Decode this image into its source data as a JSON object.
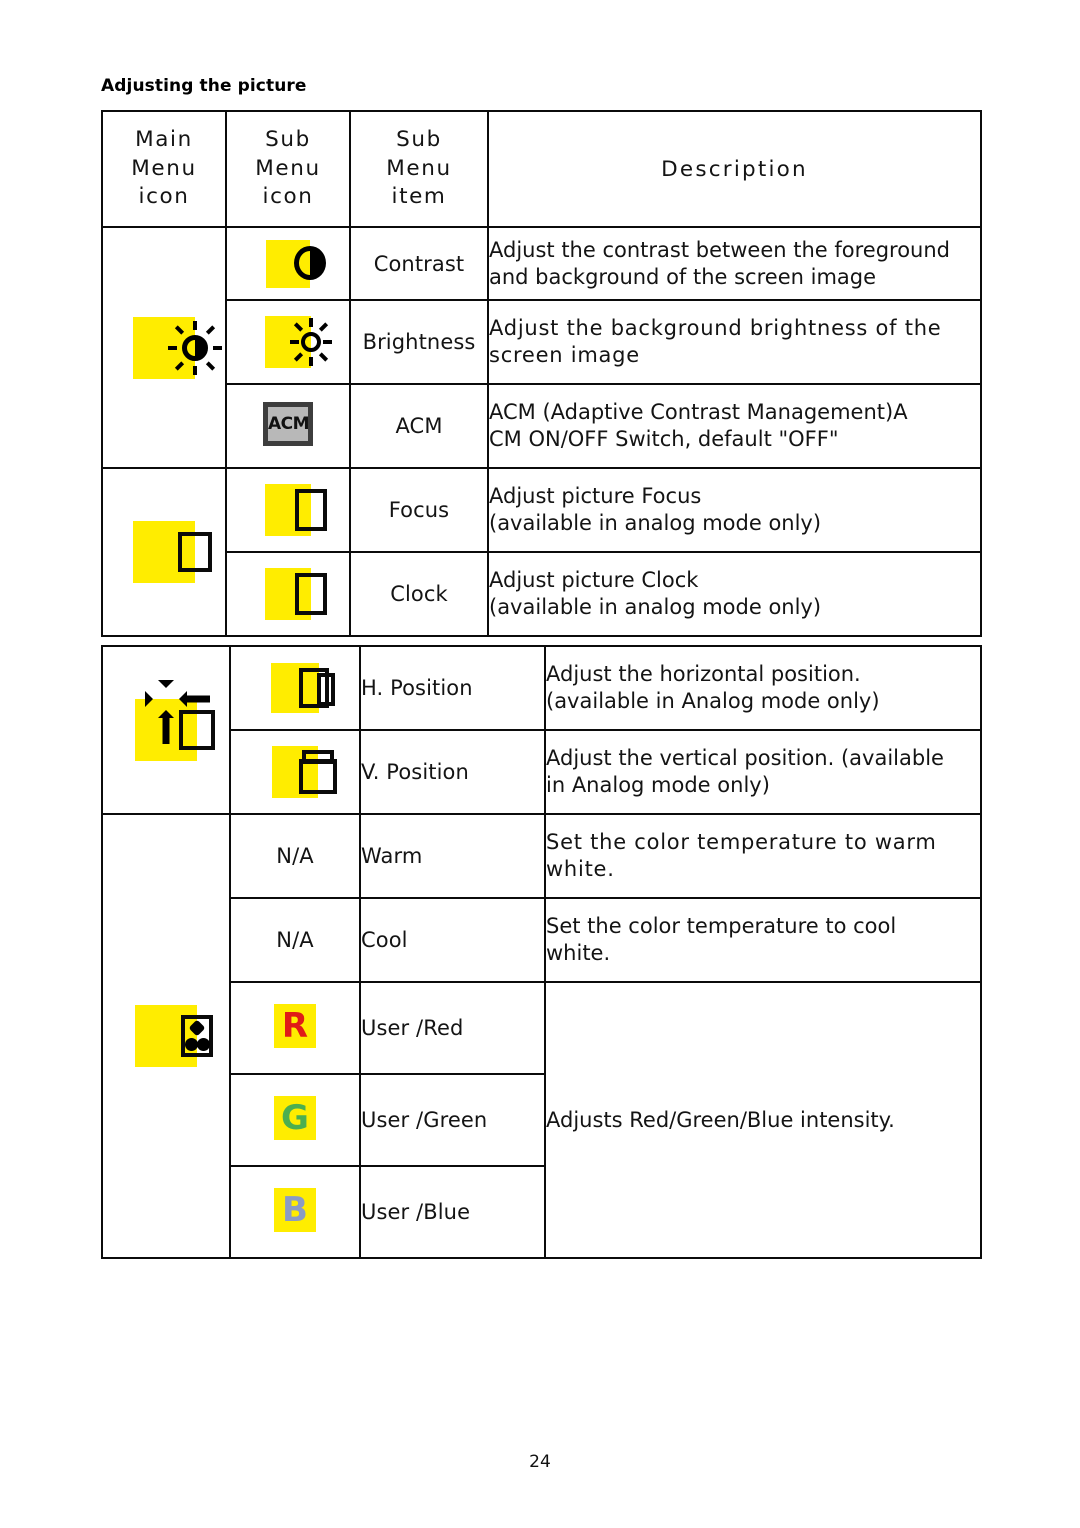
{
  "document": {
    "heading": "Adjusting the picture",
    "page_number": "24"
  },
  "table": {
    "headers": {
      "main_menu_icon": "Main\nMenu\nicon",
      "main_menu_icon_lines": [
        "Main",
        "Menu",
        "icon"
      ],
      "sub_menu_icon_lines": [
        "Sub",
        "Menu",
        "icon"
      ],
      "sub_menu_item_lines": [
        "Sub",
        "Menu",
        "item"
      ],
      "description": "Description"
    },
    "rows": [
      {
        "main_menu_icon": "brightness-sun-half-icon",
        "sub_menu_icon": "contrast-half-circle-icon",
        "sub_menu_item": "Contrast",
        "description": "Adjust the contrast between the foreground and background of the screen image"
      },
      {
        "main_menu_icon": "brightness-sun-half-icon",
        "sub_menu_icon": "brightness-sun-icon",
        "sub_menu_item": "Brightness",
        "description": "Adjust the background brightness of the screen image"
      },
      {
        "main_menu_icon": "brightness-sun-half-icon",
        "sub_menu_icon": "acm-icon",
        "sub_menu_item": "ACM",
        "description": "ACM (Adaptive Contrast Management)ACM ON/OFF Switch, default \"OFF\""
      },
      {
        "main_menu_icon": "focus-lines-icon",
        "sub_menu_icon": "focus-lines-icon",
        "sub_menu_item": "Focus",
        "description": "Adjust picture Focus (available in analog mode only)"
      },
      {
        "main_menu_icon": "focus-lines-icon",
        "sub_menu_icon": "clock-bars-icon",
        "sub_menu_item": "Clock",
        "description": "Adjust picture Clock (available in analog mode only)"
      },
      {
        "main_menu_icon": "position-arrows-icon",
        "sub_menu_icon": "h-position-icon",
        "sub_menu_item": "H. Position",
        "description": "Adjust the horizontal position. (available in Analog  mode only)"
      },
      {
        "main_menu_icon": "position-arrows-icon",
        "sub_menu_icon": "v-position-icon",
        "sub_menu_item": "V. Position",
        "description": "Adjust the vertical position. (available in Analog  mode only)"
      },
      {
        "main_menu_icon": "color-dots-icon",
        "sub_menu_icon": "N/A",
        "sub_menu_item": "Warm",
        "description": "Set the color temperature to warm white."
      },
      {
        "main_menu_icon": "color-dots-icon",
        "sub_menu_icon": "N/A",
        "sub_menu_item": "Cool",
        "description": "Set the color temperature to cool white."
      },
      {
        "main_menu_icon": "color-dots-icon",
        "sub_menu_icon": "user-red-icon",
        "sub_menu_item": "User /Red",
        "description": "Adjusts Red/Green/Blue intensity."
      },
      {
        "main_menu_icon": "color-dots-icon",
        "sub_menu_icon": "user-green-icon",
        "sub_menu_item": "User /Green",
        "description": "Adjusts Red/Green/Blue intensity."
      },
      {
        "main_menu_icon": "color-dots-icon",
        "sub_menu_icon": "user-blue-icon",
        "sub_menu_item": "User /Blue",
        "description": "Adjusts Red/Green/Blue intensity."
      }
    ],
    "descriptions": {
      "contrast_line1": "Adjust the contrast between the foreground",
      "contrast_line2": "and background of the screen image",
      "brightness_line1": "Adjust the background brightness of the",
      "brightness_line2": "screen image",
      "acm_line1": "ACM (Adaptive Contrast Management)A",
      "acm_line2": "CM ON/OFF Switch, default \"OFF\"",
      "focus_line1": "Adjust picture Focus",
      "focus_line2": "(available in analog mode only)",
      "clock_line1": "Adjust picture Clock",
      "clock_line2": "(available in analog mode only)",
      "hpos_line1": "Adjust the horizontal position.",
      "hpos_line2": "(available in Analog  mode only)",
      "vpos_line1": "Adjust the vertical position. (available",
      "vpos_line2": "in Analog  mode only)",
      "warm_line1": "Set the color temperature to warm",
      "warm_line2": "white.",
      "cool_line1": "Set the color temperature to cool",
      "cool_line2": "white.",
      "rgb": "Adjusts Red/Green/Blue intensity."
    },
    "items": {
      "contrast": "Contrast",
      "brightness": "Brightness",
      "acm": "ACM",
      "focus": "Focus",
      "clock": "Clock",
      "h_position": "H. Position",
      "v_position": "V. Position",
      "warm": "Warm",
      "cool": "Cool",
      "user_red": "User /Red",
      "user_green": "User /Green",
      "user_blue": "User /Blue",
      "na": "N/A"
    },
    "icon_labels": {
      "acm_text": "ACM",
      "red_letter": "R",
      "green_letter": "G",
      "blue_letter": "B"
    }
  },
  "colors": {
    "icon_yellow": "#ffed00",
    "icon_black": "#000000",
    "acm_gray": "#b8b8b8",
    "red": "#e01b17",
    "green": "#4caf50",
    "blue": "#8a9bc4",
    "border": "#0b0b0b"
  }
}
